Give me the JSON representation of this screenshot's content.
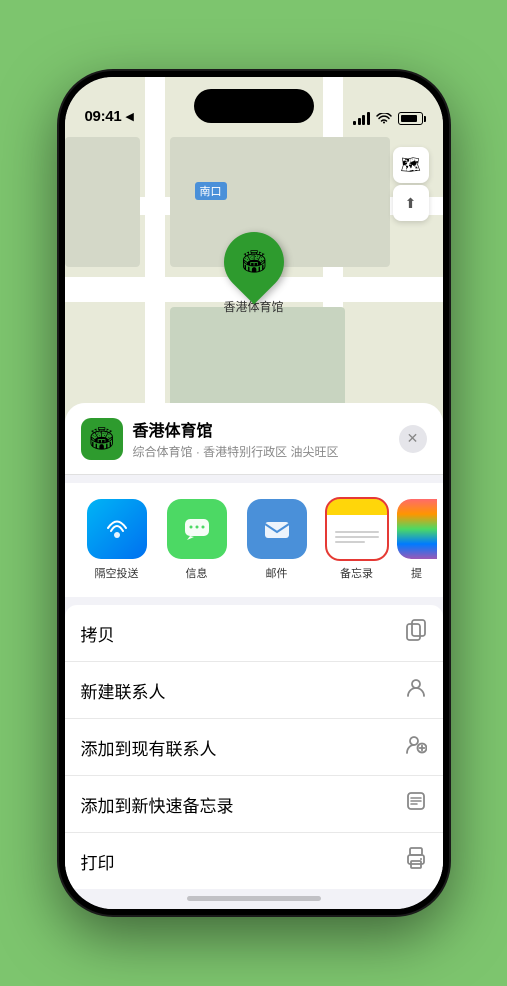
{
  "status_bar": {
    "time": "09:41",
    "location_arrow": "▶"
  },
  "map": {
    "label_nankou": "南口",
    "controls": {
      "map_icon": "🗺",
      "location_icon": "➤"
    },
    "pin_label": "香港体育馆",
    "pin_emoji": "🏟"
  },
  "venue": {
    "name": "香港体育馆",
    "description": "综合体育馆 · 香港特别行政区 油尖旺区",
    "close_symbol": "✕",
    "icon_emoji": "🏟"
  },
  "share_items": [
    {
      "id": "airdrop",
      "label": "隔空投送",
      "type": "airdrop"
    },
    {
      "id": "message",
      "label": "信息",
      "type": "message"
    },
    {
      "id": "mail",
      "label": "邮件",
      "type": "mail"
    },
    {
      "id": "notes",
      "label": "备忘录",
      "type": "notes"
    },
    {
      "id": "more",
      "label": "提",
      "type": "more"
    }
  ],
  "actions": [
    {
      "id": "copy",
      "label": "拷贝",
      "icon": "copy"
    },
    {
      "id": "new-contact",
      "label": "新建联系人",
      "icon": "person"
    },
    {
      "id": "add-contact",
      "label": "添加到现有联系人",
      "icon": "person-add"
    },
    {
      "id": "quick-note",
      "label": "添加到新快速备忘录",
      "icon": "note"
    },
    {
      "id": "print",
      "label": "打印",
      "icon": "print"
    }
  ],
  "colors": {
    "accent_green": "#2e9b2e",
    "notes_yellow": "#ffd60a",
    "notes_red": "#e53935",
    "action_border": "#e53935"
  }
}
